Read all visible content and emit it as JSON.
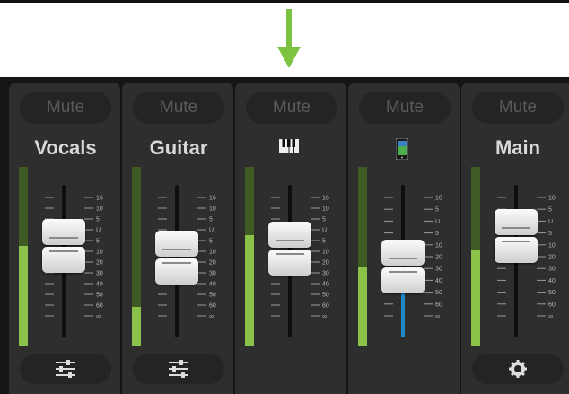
{
  "channels": [
    {
      "name": "Vocals",
      "mute_label": "Mute",
      "label": "Vocals",
      "icon": "",
      "meter_level": 0.56,
      "fader_level": 0.72,
      "footer_icon": "sliders-icon",
      "scale": [
        "16",
        "10",
        "5",
        "U",
        "5",
        "10",
        "20",
        "30",
        "40",
        "50",
        "60",
        "∞"
      ]
    },
    {
      "name": "Guitar",
      "mute_label": "Mute",
      "label": "Guitar",
      "icon": "",
      "meter_level": 0.22,
      "fader_level": 0.64,
      "footer_icon": "sliders-icon",
      "scale": [
        "16",
        "10",
        "5",
        "U",
        "5",
        "10",
        "20",
        "30",
        "40",
        "50",
        "60",
        "∞"
      ]
    },
    {
      "name": "Keys",
      "mute_label": "Mute",
      "label": "",
      "icon": "piano-icon",
      "meter_level": 0.62,
      "fader_level": 0.7,
      "footer_icon": "",
      "scale": [
        "16",
        "10",
        "5",
        "U",
        "5",
        "10",
        "20",
        "30",
        "40",
        "50",
        "60",
        "∞"
      ]
    },
    {
      "name": "Device",
      "mute_label": "Mute",
      "label": "",
      "icon": "phone-icon",
      "meter_level": 0.44,
      "fader_level": 0.58,
      "footer_icon": "",
      "scale": [
        "10",
        "5",
        "U",
        "5",
        "10",
        "20",
        "30",
        "40",
        "50",
        "60",
        "∞"
      ],
      "blue_level": 0.34
    },
    {
      "name": "Main",
      "mute_label": "Mute",
      "label": "Main",
      "icon": "",
      "meter_level": 0.54,
      "fader_level": 0.78,
      "footer_icon": "gear-icon",
      "scale": [
        "10",
        "5",
        "U",
        "5",
        "10",
        "20",
        "30",
        "40",
        "50",
        "60",
        "∞"
      ]
    }
  ],
  "colors": {
    "meter_fill": "#8bc34a",
    "meter_bg": "#3f5a22",
    "arrow": "#7cc342",
    "accent_blue": "#1e88c8"
  }
}
